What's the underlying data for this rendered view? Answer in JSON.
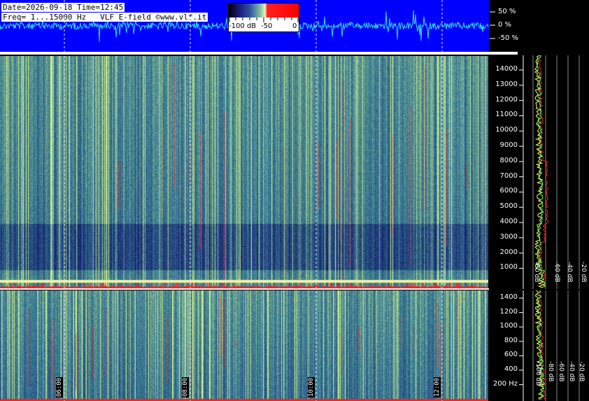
{
  "header": {
    "line1": "Date=2026-09-18 Time=12:45",
    "line2": "Freq= 1...15000 Hz   VLF E-field ©www.vlf.it"
  },
  "colorbar": {
    "labels": [
      "-100 dB",
      "-50",
      "0"
    ]
  },
  "amplitude_axis": {
    "labels": [
      "50 %",
      "0 %",
      "-50 %"
    ]
  },
  "spectrum_upper": {
    "freq_labels": [
      "14000",
      "13000",
      "12000",
      "11000",
      "10000",
      "9000",
      "8000",
      "7000",
      "6000",
      "5000",
      "4000",
      "3000",
      "2000",
      "1000"
    ],
    "db_labels": [
      "-80 dB",
      "-60 dB",
      "-40 dB",
      "-20 dB"
    ]
  },
  "spectrum_lower": {
    "freq_labels": [
      "1400",
      "1200",
      "1000",
      "800",
      "600",
      "400",
      "200 Hz"
    ],
    "db_labels": [
      "-100 dB",
      "-80 dB",
      "-60 dB",
      "-40 dB",
      "-20 dB"
    ]
  },
  "time_markers": {
    "labels": [
      "06:00",
      "08:00",
      "10:00",
      "12:00"
    ]
  },
  "colors": {
    "waveform_bg": "#0000ff",
    "waveform_trace": "#33ddee",
    "spectro_low": "#1a2a7a",
    "spectro_high": "#7fc8a0",
    "trace_red": "#ff2020",
    "trace_yellow": "#ffff60",
    "trace_green": "#60ff60"
  }
}
